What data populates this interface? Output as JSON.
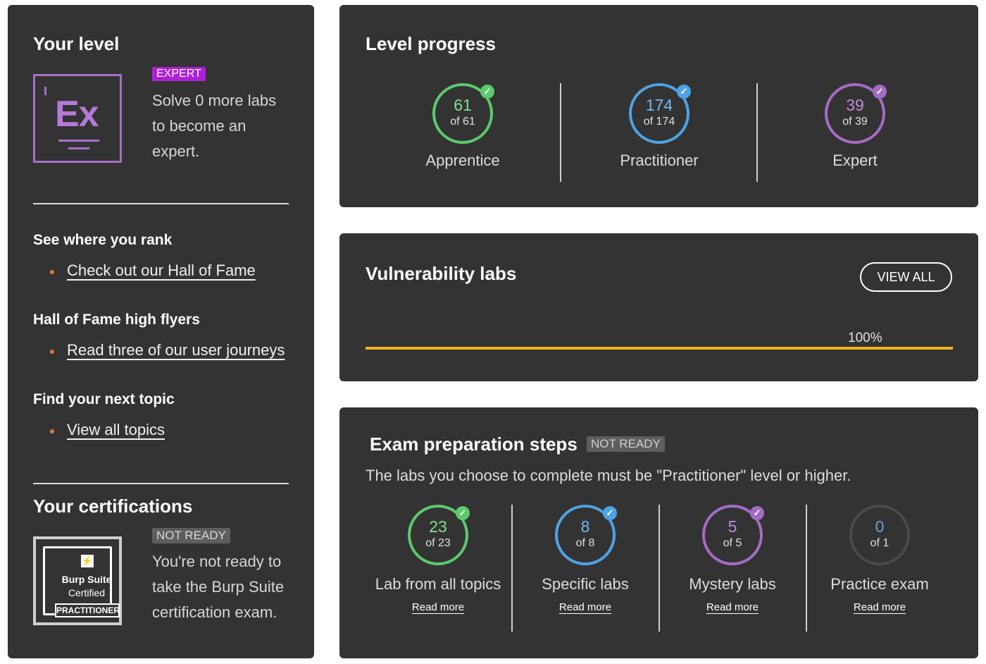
{
  "level": {
    "title": "Your level",
    "badge_text": "Ex",
    "tag": "EXPERT",
    "message": "Solve 0 more labs to become an expert."
  },
  "rank": {
    "heading": "See where you rank",
    "link": "Check out our Hall of Fame"
  },
  "flyers": {
    "heading": "Hall of Fame high flyers",
    "link": "Read three of our user journeys"
  },
  "topic": {
    "heading": "Find your next topic",
    "link": "View all topics"
  },
  "certifications": {
    "title": "Your certifications",
    "badge_line1": "Burp Suite",
    "badge_line2": "Certified",
    "badge_line3": "PRACTITIONER",
    "badge_icon": "lightning-bolt-icon",
    "tag": "NOT READY",
    "message": "You're not ready to take the Burp Suite certification exam."
  },
  "progress": {
    "title": "Level progress",
    "items": [
      {
        "value": "61",
        "of": "of 61",
        "label": "Apprentice",
        "color": "#5cc96c",
        "complete": true
      },
      {
        "value": "174",
        "of": "of 174",
        "label": "Practitioner",
        "color": "#4da3e6",
        "complete": true
      },
      {
        "value": "39",
        "of": "of 39",
        "label": "Expert",
        "color": "#a56bc6",
        "complete": true
      }
    ]
  },
  "vuln": {
    "title": "Vulnerability labs",
    "view_all": "VIEW ALL",
    "percent_label": "100%",
    "percent": 100,
    "bar_color": "#f0b429"
  },
  "exam": {
    "title": "Exam preparation steps",
    "tag": "NOT READY",
    "message": "The labs you choose to complete must be \"Practitioner\" level or higher.",
    "steps": [
      {
        "value": "23",
        "of": "of 23",
        "label": "Lab from all topics",
        "link": "Read more",
        "color": "#5cc96c",
        "complete": true
      },
      {
        "value": "8",
        "of": "of 8",
        "label": "Specific labs",
        "link": "Read more",
        "color": "#4da3e6",
        "complete": true
      },
      {
        "value": "5",
        "of": "of 5",
        "label": "Mystery labs",
        "link": "Read more",
        "color": "#a56bc6",
        "complete": true
      },
      {
        "value": "0",
        "of": "of 1",
        "label": "Practice exam",
        "link": "Read more",
        "color": "#4a4a4a",
        "complete": false
      }
    ]
  }
}
